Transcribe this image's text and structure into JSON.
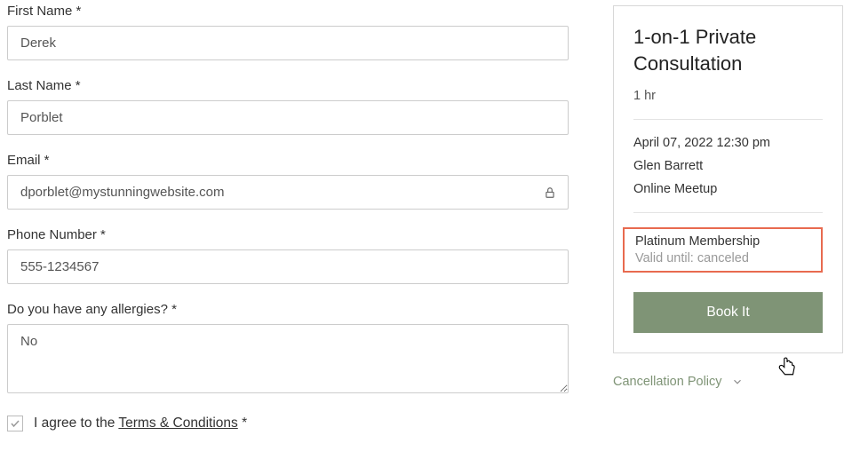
{
  "form": {
    "first_name": {
      "label": "First Name *",
      "value": "Derek"
    },
    "last_name": {
      "label": "Last Name *",
      "value": "Porblet"
    },
    "email": {
      "label": "Email *",
      "value": "dporblet@mystunningwebsite.com"
    },
    "phone": {
      "label": "Phone Number *",
      "value": "555-1234567"
    },
    "allergies": {
      "label": "Do you have any allergies? *",
      "value": "No"
    },
    "agree_prefix": "I agree to the ",
    "terms_link": "Terms & Conditions",
    "agree_suffix": " *"
  },
  "sidebar": {
    "title": "1-on-1 Private Consultation",
    "duration": "1 hr",
    "datetime": "April 07, 2022 12:30 pm",
    "staff": "Glen Barrett",
    "location": "Online Meetup",
    "membership_name": "Platinum Membership",
    "membership_valid": "Valid until: canceled",
    "book_label": "Book It",
    "cancellation_label": "Cancellation Policy"
  }
}
